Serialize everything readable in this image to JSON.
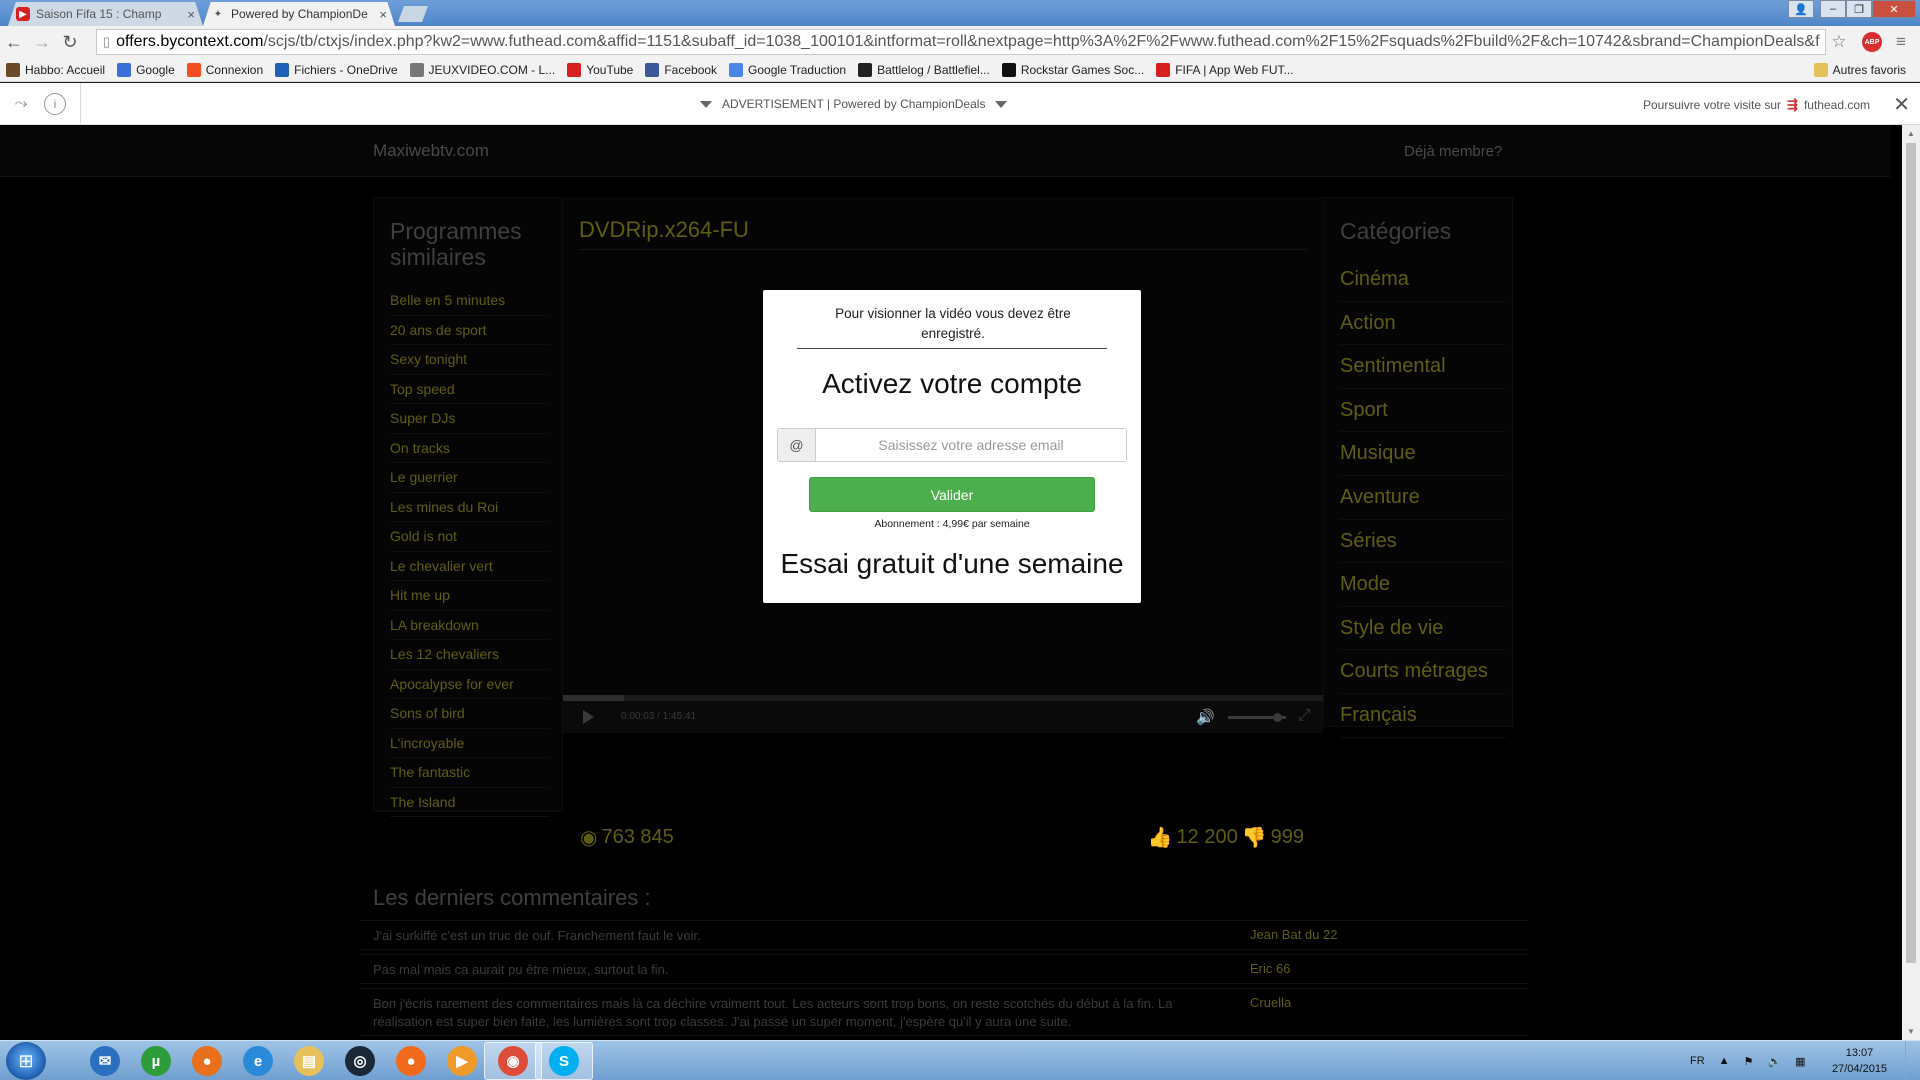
{
  "browser": {
    "tabs": [
      {
        "title": "Saison Fifa 15 : Champ",
        "icon": "youtube-icon",
        "active": false
      },
      {
        "title": "Powered by ChampionDe",
        "icon": "championdeals-icon",
        "active": true
      }
    ],
    "url_host": "offers.bycontext.com",
    "url_path": "/scjs/tb/ctxjs/index.php?kw2=www.futhead.com&affid=1151&subaff_id=1038_100101&intformat=roll&nextpage=http%3A%2F%2Fwww.futhead.com%2F15%2Fsquads%2Fbuild%2F&ch=10742&sbrand=ChampionDeals&f",
    "abp_label": "ABP",
    "bookmarks": [
      {
        "label": "Habbo: Accueil",
        "icon": "habbo-icon",
        "color": "#6a4a2a"
      },
      {
        "label": "Google",
        "icon": "google-icon",
        "color": "#3b6fd8"
      },
      {
        "label": "Connexion",
        "icon": "windows-icon",
        "color": "#f25022"
      },
      {
        "label": "Fichiers - OneDrive",
        "icon": "onedrive-icon",
        "color": "#1f5fb8"
      },
      {
        "label": "JEUXVIDEO.COM - L...",
        "icon": "jeuxvideo-icon",
        "color": "#777"
      },
      {
        "label": "YouTube",
        "icon": "youtube-icon",
        "color": "#d62020"
      },
      {
        "label": "Facebook",
        "icon": "facebook-icon",
        "color": "#3b5998"
      },
      {
        "label": "Google Traduction",
        "icon": "translate-icon",
        "color": "#4a86e8"
      },
      {
        "label": "Battlelog / Battlefiel...",
        "icon": "battlelog-icon",
        "color": "#222"
      },
      {
        "label": "Rockstar Games Soc...",
        "icon": "rockstar-icon",
        "color": "#111"
      },
      {
        "label": "FIFA | App Web FUT...",
        "icon": "ea-icon",
        "color": "#d62020"
      }
    ],
    "other_bookmarks": "Autres favoris"
  },
  "adbar": {
    "center_text": "ADVERTISEMENT | Powered by ChampionDeals",
    "right_text": "Poursuivre votre visite sur",
    "right_site": "futhead.com"
  },
  "site": {
    "logo": "Maxiwebtv.com",
    "member_link": "Déjà membre?",
    "left_title": "Programmes similaires",
    "programs": [
      "Belle en 5 minutes",
      "20 ans de sport",
      "Sexy tonight",
      "Top speed",
      "Super DJs",
      "On tracks",
      "Le guerrier",
      "Les mines du Roi",
      "Gold is not",
      "Le chevalier vert",
      "Hit me up",
      "LA breakdown",
      "Les 12 chevaliers",
      "Apocalypse for ever",
      "Sons of bird",
      "L'incroyable",
      "The fantastic",
      "The Island"
    ],
    "video_title": "DVDRip.x264-FU",
    "video_time": "0:00:03 / 1:45:41",
    "video_progress_fraction": 0.08,
    "volume_fraction": 0.85,
    "right_title": "Catégories",
    "categories": [
      "Cinéma",
      "Action",
      "Sentimental",
      "Sport",
      "Musique",
      "Aventure",
      "Séries",
      "Mode",
      "Style de vie",
      "Courts métrages",
      "Français"
    ],
    "views": "763 845",
    "likes": "12 200",
    "dislikes": "999",
    "comments_title": "Les derniers commentaires :",
    "comments": [
      {
        "text": "J'ai surkiffé c'est un truc de ouf. Franchement faut le voir.",
        "author": "Jean Bat du 22"
      },
      {
        "text": "Pas mal mais ca aurait pu être mieux, surtout la fin.",
        "author": "Eric 66"
      },
      {
        "text": "Bon j'écris rarement des commentaires mais là ca déchire vraiment tout. Les acteurs sont trop bons, on reste scotchés du début à la fin. La réalisation est super bien faite, les lumières sont trop classes. J'ai passé un super moment, j'espère qu'il y aura une suite.",
        "author": "Cruella"
      }
    ]
  },
  "modal": {
    "message": "Pour visionner la vidéo vous devez être enregistré.",
    "title": "Activez votre compte",
    "email_addon": "@",
    "email_placeholder": "Saisissez votre adresse email",
    "email_value": "",
    "submit_label": "Valider",
    "subscription": "Abonnement : 4,99€ par semaine",
    "trial": "Essai gratuit d'une semaine",
    "button_color": "#4cae4c"
  },
  "taskbar": {
    "apps": [
      {
        "name": "thunderbird",
        "icon": "thunderbird-icon",
        "color": "#2a6fc0",
        "glyph": "✉"
      },
      {
        "name": "utorrent",
        "icon": "utorrent-icon",
        "color": "#2e9c3a",
        "glyph": "µ"
      },
      {
        "name": "firefox",
        "icon": "firefox-icon",
        "color": "#e8701c",
        "glyph": "●"
      },
      {
        "name": "internet-explorer",
        "icon": "ie-icon",
        "color": "#2a8ad8",
        "glyph": "e"
      },
      {
        "name": "explorer",
        "icon": "folder-icon",
        "color": "#e6c15a",
        "glyph": "▤"
      },
      {
        "name": "steam",
        "icon": "steam-icon",
        "color": "#1b2838",
        "glyph": "◎"
      },
      {
        "name": "origin",
        "icon": "origin-icon",
        "color": "#f26a1b",
        "glyph": "●"
      },
      {
        "name": "media-player",
        "icon": "media-player-icon",
        "color": "#f09a2a",
        "glyph": "▶"
      },
      {
        "name": "chrome",
        "icon": "chrome-icon",
        "color": "#dd4b39",
        "glyph": "◉"
      },
      {
        "name": "skype",
        "icon": "skype-icon",
        "color": "#00aff0",
        "glyph": "S"
      }
    ],
    "language": "FR",
    "time": "13:07",
    "date": "27/04/2015"
  }
}
